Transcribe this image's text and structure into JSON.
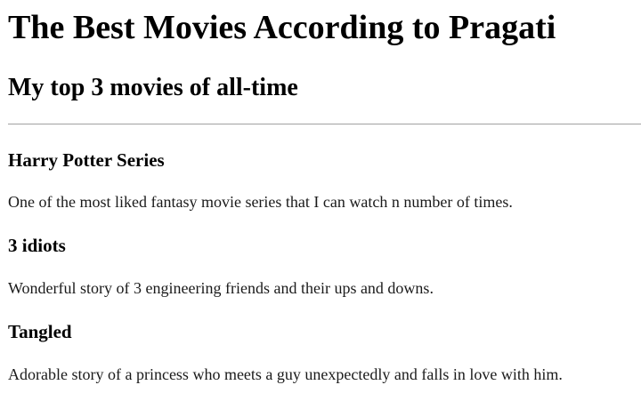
{
  "page": {
    "title": "The Best Movies According to Pragati",
    "subtitle": "My top 3 movies of all-time"
  },
  "movies": [
    {
      "name": "Harry Potter Series",
      "description": "One of the most liked fantasy movie series that I can watch n number of times."
    },
    {
      "name": "3 idiots",
      "description": "Wonderful story of 3 engineering friends and their ups and downs."
    },
    {
      "name": "Tangled",
      "description": "Adorable story of a princess who meets a guy unexpectedly and falls in love with him."
    }
  ]
}
